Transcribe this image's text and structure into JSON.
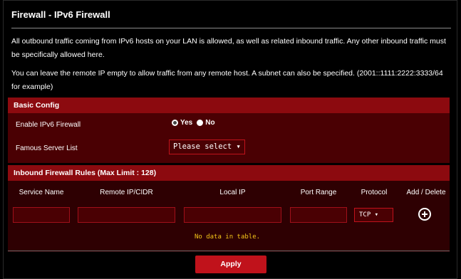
{
  "page": {
    "title": "Firewall - IPv6 Firewall",
    "description1": "All outbound traffic coming from IPv6 hosts on your LAN is allowed, as well as related inbound traffic. Any other inbound traffic must be specifically allowed here.",
    "description2": "You can leave the remote IP empty to allow traffic from any remote host. A subnet can also be specified. (2001::1111:2222:3333/64 for example)"
  },
  "basic_config": {
    "header": "Basic Config",
    "enable_label": "Enable IPv6 Firewall",
    "yes_label": "Yes",
    "no_label": "No",
    "enabled": "Yes",
    "famous_label": "Famous Server List",
    "famous_select_value": "Please select ▾"
  },
  "inbound": {
    "header": "Inbound Firewall Rules (Max Limit : 128)",
    "columns": [
      "Service Name",
      "Remote IP/CIDR",
      "Local IP",
      "Port Range",
      "Protocol",
      "Add / Delete"
    ],
    "protocol_value": "TCP  ▾",
    "no_data": "No data in table."
  },
  "footer": {
    "apply_label": "Apply"
  },
  "colors": {
    "header_bar": "#8c0a0f",
    "accent": "#c0121b",
    "no_data_text": "#f3c419"
  },
  "icons": {
    "add": "plus-circle-icon"
  }
}
